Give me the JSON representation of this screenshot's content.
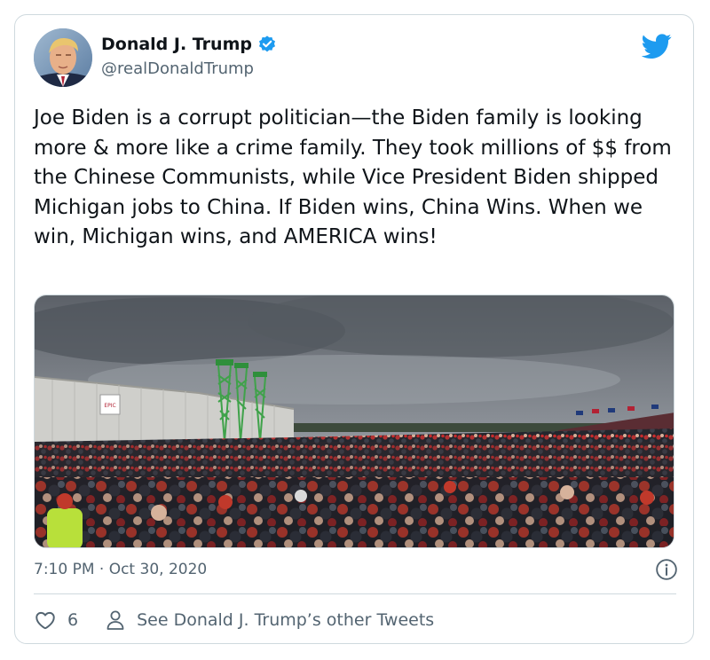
{
  "tweet": {
    "author_name": "Donald J. Trump",
    "author_handle": "@realDonaldTrump",
    "text": "Joe Biden is a corrupt politician—the Biden family is looking more & more like a crime family. They took millions of $$ from the Chinese Communists, while Vice President Biden shipped Michigan jobs to China. If Biden wins, China Wins. When we win, Michigan wins, and AMERICA wins!",
    "timestamp": "7:10 PM · Oct 30, 2020",
    "like_count": "6",
    "profile_link_label": "See Donald J. Trump’s other Tweets"
  },
  "media": {
    "sign_text": "EPIC"
  },
  "icons": {
    "verified": "verified-badge-icon",
    "brand": "twitter-bird-icon",
    "info": "info-icon",
    "like": "heart-icon",
    "profile": "person-icon"
  },
  "colors": {
    "accent": "#1d9bf0",
    "text_primary": "#0f1419",
    "text_secondary": "#536471",
    "border": "#cfd9de"
  }
}
